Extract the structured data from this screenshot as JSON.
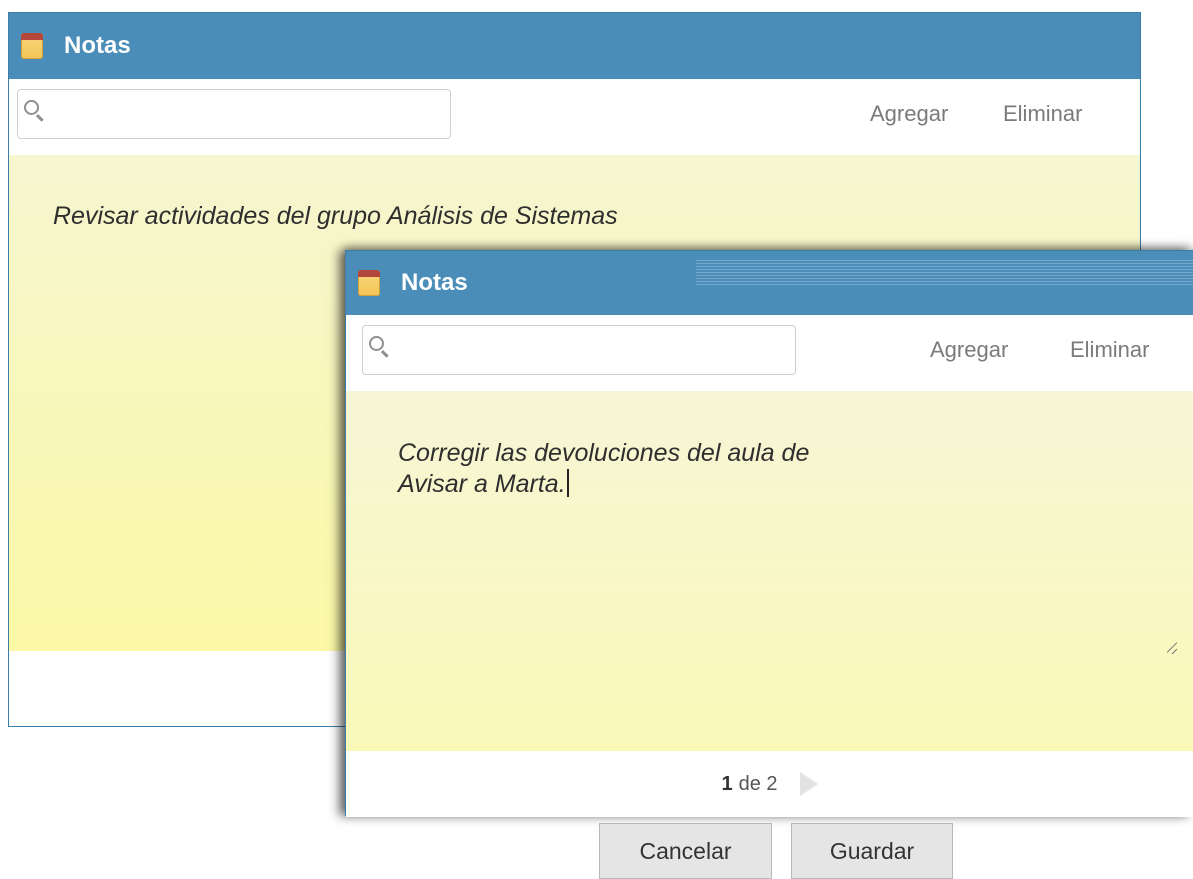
{
  "back_window": {
    "title": "Notas",
    "icon": "note-icon",
    "search": {
      "placeholder": ""
    },
    "actions": {
      "add": "Agregar",
      "delete": "Eliminar"
    },
    "note_text": "Revisar actividades del grupo Análisis de Sistemas"
  },
  "front_window": {
    "title": "Notas",
    "icon": "note-icon",
    "search": {
      "placeholder": ""
    },
    "actions": {
      "add": "Agregar",
      "delete": "Eliminar"
    },
    "note_lines": [
      "Corregir las devoluciones del aula de",
      "Avisar a Marta."
    ],
    "buttons": {
      "cancel": "Cancelar",
      "save": "Guardar"
    },
    "pager": {
      "current": "1",
      "separator": "de",
      "total": "2"
    }
  },
  "colors": {
    "titlebar": "#4a8db8",
    "note_background": "#fbf8a6",
    "action_text": "#7b7b7b"
  }
}
